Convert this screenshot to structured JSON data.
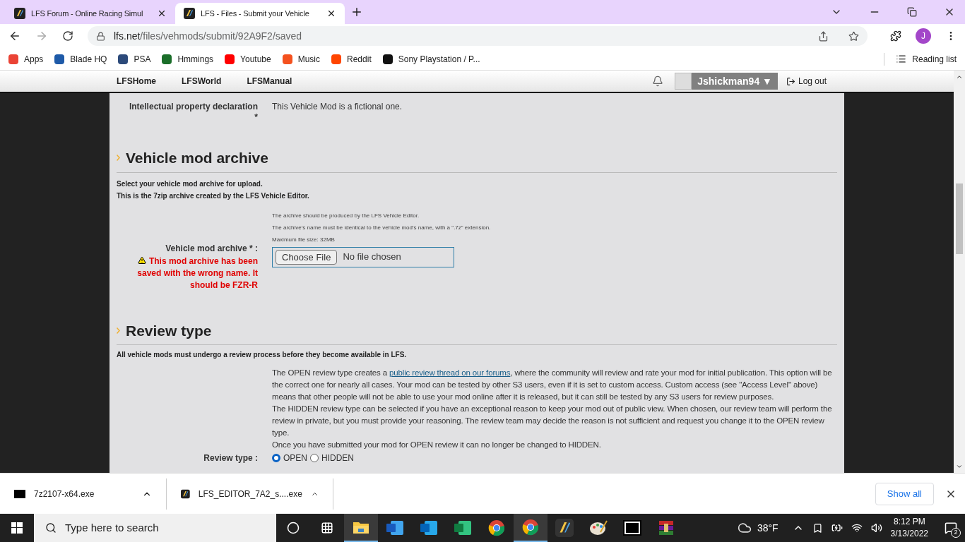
{
  "browser_tabs": [
    {
      "title": "LFS Forum - Online Racing Simul",
      "selected": false
    },
    {
      "title": "LFS - Files - Submit your Vehicle",
      "selected": true
    }
  ],
  "address_bar": {
    "host": "lfs.net",
    "path": "/files/vehmods/submit/92A9F2/saved"
  },
  "profile_initial": "J",
  "bookmarks": [
    {
      "label": "Apps",
      "color": "#ea4335"
    },
    {
      "label": "Blade HQ",
      "color": "#1e5aa8"
    },
    {
      "label": "PSA",
      "color": "#2c4a7a"
    },
    {
      "label": "Hmmings",
      "color": "#1b6e2a"
    },
    {
      "label": "Youtube",
      "color": "#ff0000"
    },
    {
      "label": "Music",
      "color": "#f4511e"
    },
    {
      "label": "Reddit",
      "color": "#ff4500"
    },
    {
      "label": "Sony Playstation / P...",
      "color": "#111111"
    }
  ],
  "reading_list": "Reading list",
  "site_nav": {
    "links": [
      "LFSHome",
      "LFSWorld",
      "LFSManual"
    ],
    "user": "Jshickman94 ▼",
    "logout": "Log out"
  },
  "ip_row": {
    "label": "Intellectual property declaration",
    "required": "*",
    "value": "This Vehicle Mod is a fictional one."
  },
  "archive_section": {
    "heading": "Vehicle mod archive",
    "intro": [
      "Select your vehicle mod archive for upload.",
      "This is the 7zip archive created by the LFS Vehicle Editor."
    ],
    "help": [
      "The archive should be produced by the LFS Vehicle Editor.",
      "The archive's name must be identical to the vehicle mod's name, with a \".7z\" extension.",
      "Maximum file size: 32MB"
    ],
    "label": "Vehicle mod archive * :",
    "error": "This mod archive has been saved with the wrong name. It should be FZR-R",
    "button": "Choose File",
    "file_status": "No file chosen"
  },
  "review_section": {
    "heading": "Review type",
    "intro": "All vehicle mods must undergo a review process before they become available in LFS.",
    "paragraph_1_before": "The OPEN review type creates a ",
    "paragraph_1_link": "public review thread on our forums",
    "paragraph_1_after": ", where the community will review and rate your mod for initial publication. This option will be the correct one for nearly all cases. Your mod can be tested by other S3 users, even if it is set to custom access. Custom access (see \"Access Level\" above) means that other people will not be able to use your mod online after it is released, but it can still be tested by any S3 users for review purposes.",
    "paragraph_2": "The HIDDEN review type can be selected if you have an exceptional reason to keep your mod out of public view. When chosen, our review team will perform the review in private, but you must provide your reasoning. The review team may decide the reason is not sufficient and request you change it to the OPEN review type.",
    "paragraph_3": "Once you have submitted your mod for OPEN review it can no longer be changed to HIDDEN.",
    "label": "Review type :",
    "options": [
      {
        "label": "OPEN",
        "selected": true
      },
      {
        "label": "HIDDEN",
        "selected": false
      }
    ]
  },
  "downloads": [
    {
      "name": "7z2107-x64.exe",
      "kind": "sevenzip"
    },
    {
      "name": "LFS_EDITOR_7A2_s....exe",
      "kind": "lfs"
    }
  ],
  "show_all": "Show all",
  "taskbar": {
    "search_placeholder": "Type here to search",
    "apps": [
      {
        "kind": "explorer",
        "selected": true
      },
      {
        "kind": "word",
        "selected": false
      },
      {
        "kind": "outlook",
        "selected": false
      },
      {
        "kind": "excel",
        "selected": false
      },
      {
        "kind": "chrome",
        "selected": false
      },
      {
        "kind": "chrome",
        "selected": true
      },
      {
        "kind": "lfs",
        "selected": false
      },
      {
        "kind": "paint",
        "selected": false
      },
      {
        "kind": "sevenzip",
        "selected": false
      },
      {
        "kind": "winrar",
        "selected": false
      }
    ],
    "temperature": "38°F",
    "time": "8:12 PM",
    "date": "3/13/2022",
    "notifications": "2"
  }
}
